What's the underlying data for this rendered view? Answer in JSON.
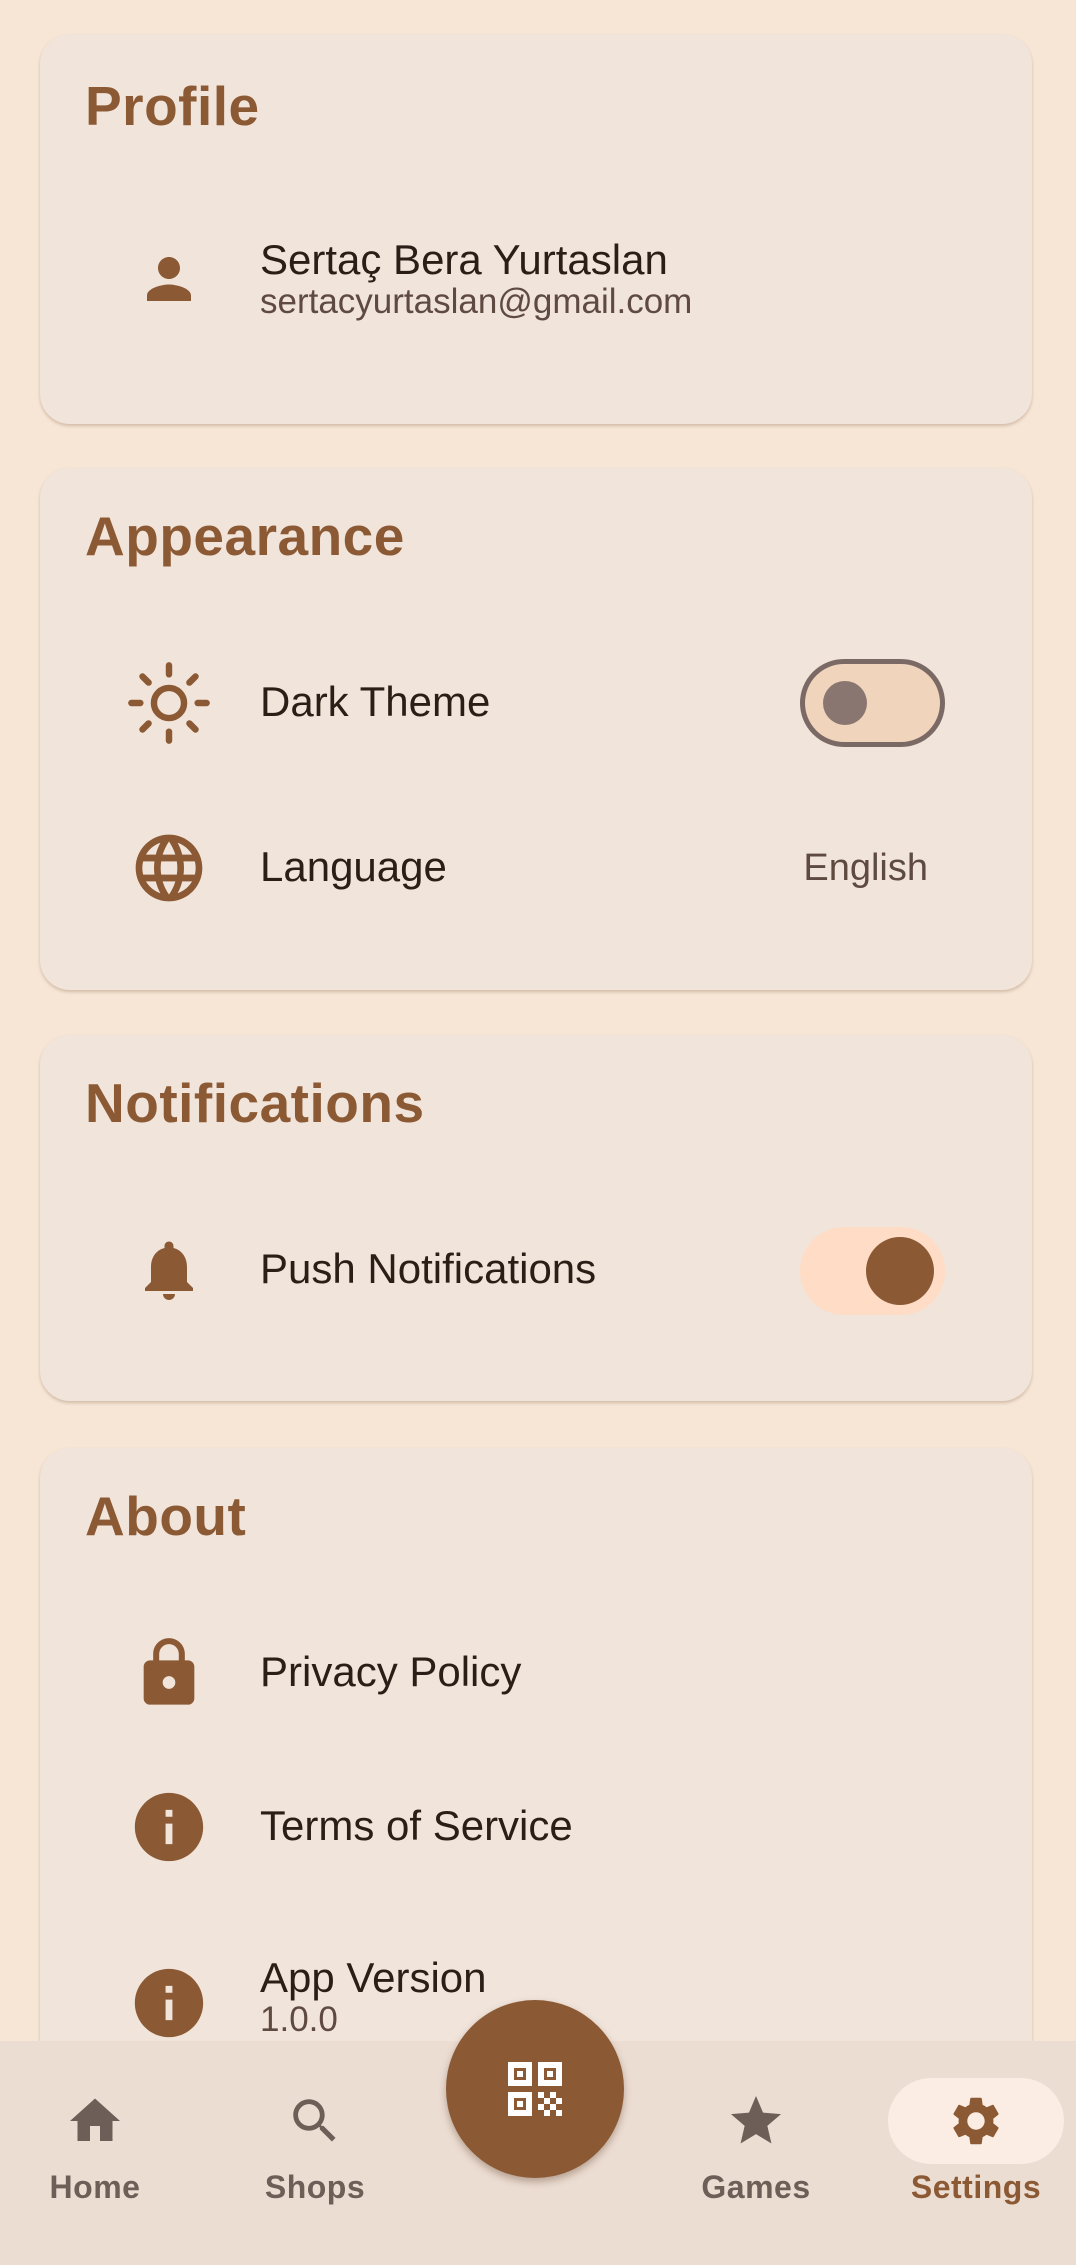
{
  "profile": {
    "title": "Profile",
    "name": "Sertaç Bera Yurtaslan",
    "email": "sertacyurtaslan@gmail.com"
  },
  "appearance": {
    "title": "Appearance",
    "dark_theme_label": "Dark Theme",
    "dark_theme_on": false,
    "language_label": "Language",
    "language_value": "English"
  },
  "notifications": {
    "title": "Notifications",
    "push_label": "Push Notifications",
    "push_on": true
  },
  "about": {
    "title": "About",
    "privacy_label": "Privacy Policy",
    "terms_label": "Terms of Service",
    "version_label": "App Version",
    "version_value": "1.0.0"
  },
  "nav": {
    "items": [
      {
        "label": "Home",
        "icon": "home-icon"
      },
      {
        "label": "Shops",
        "icon": "search-icon"
      },
      {
        "label": "Games",
        "icon": "star-icon"
      },
      {
        "label": "Settings",
        "icon": "gear-icon"
      }
    ],
    "active": "Settings",
    "fab_icon": "qr-code-icon"
  },
  "colors": {
    "accent": "#8b5a35",
    "background": "#f7e6d6",
    "card": "#f1e4da",
    "bottom_bar": "#ecddd3"
  }
}
